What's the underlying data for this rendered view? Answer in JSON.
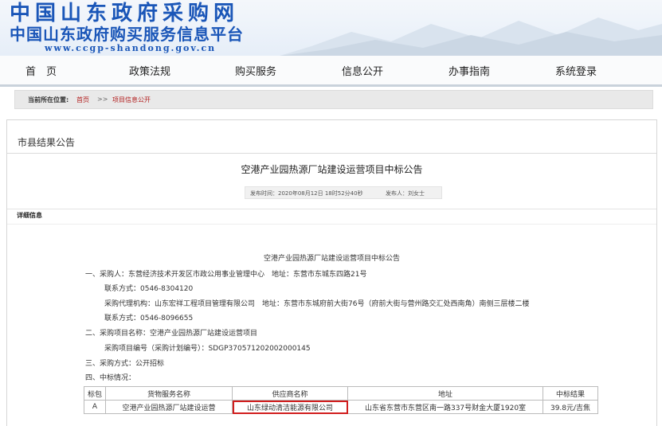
{
  "header": {
    "title": "中国山东政府采购网",
    "subtitle": "中国山东政府购买服务信息平台",
    "url": "www.ccgp-shandong.gov.cn"
  },
  "nav": {
    "items": [
      "首　页",
      "政策法规",
      "购买服务",
      "信息公开",
      "办事指南",
      "系统登录"
    ]
  },
  "breadcrumb": {
    "label": "当前所在位置:",
    "home": "首页",
    "separator": ">>",
    "current": "项目信息公开"
  },
  "panel": {
    "title": "市县结果公告"
  },
  "notice": {
    "title": "空港产业园热源厂站建设运营项目中标公告",
    "publish_time": "发布时间：2020年08月12日 18时52分40秒",
    "publisher": "发布人：刘女士",
    "section_label": "详细信息",
    "body_title": "空港产业园热源厂站建设运营项目中标公告",
    "lines": [
      "一、采购人：东营经济技术开发区市政公用事业管理中心　地址：东营市东城东四路21号",
      "联系方式：0546-8304120",
      "采购代理机构：山东宏祥工程项目管理有限公司　地址：东营市东城府前大街76号（府前大街与营州路交汇处西南角）南侧三层楼二楼",
      "联系方式：0546-8096655",
      "二、采购项目名称：空港产业园热源厂站建设运营项目",
      "采购项目编号（采购计划编号）：SDGP370571202002000145",
      "三、采购方式：公开招标",
      "四、中标情况："
    ]
  },
  "table": {
    "headers": [
      "标包",
      "货物服务名称",
      "供应商名称",
      "地址",
      "中标结果"
    ],
    "rows": [
      [
        "A",
        "空港产业园热源厂站建设运营",
        "山东绿动清洁能源有限公司",
        "山东省东营市东营区南一路337号财金大厦1920室",
        "39.8元/吉焦"
      ]
    ]
  },
  "colors": {
    "brand_blue": "#1a56b8",
    "link_red": "#b21e1e",
    "highlight_red": "#d11e1e"
  }
}
